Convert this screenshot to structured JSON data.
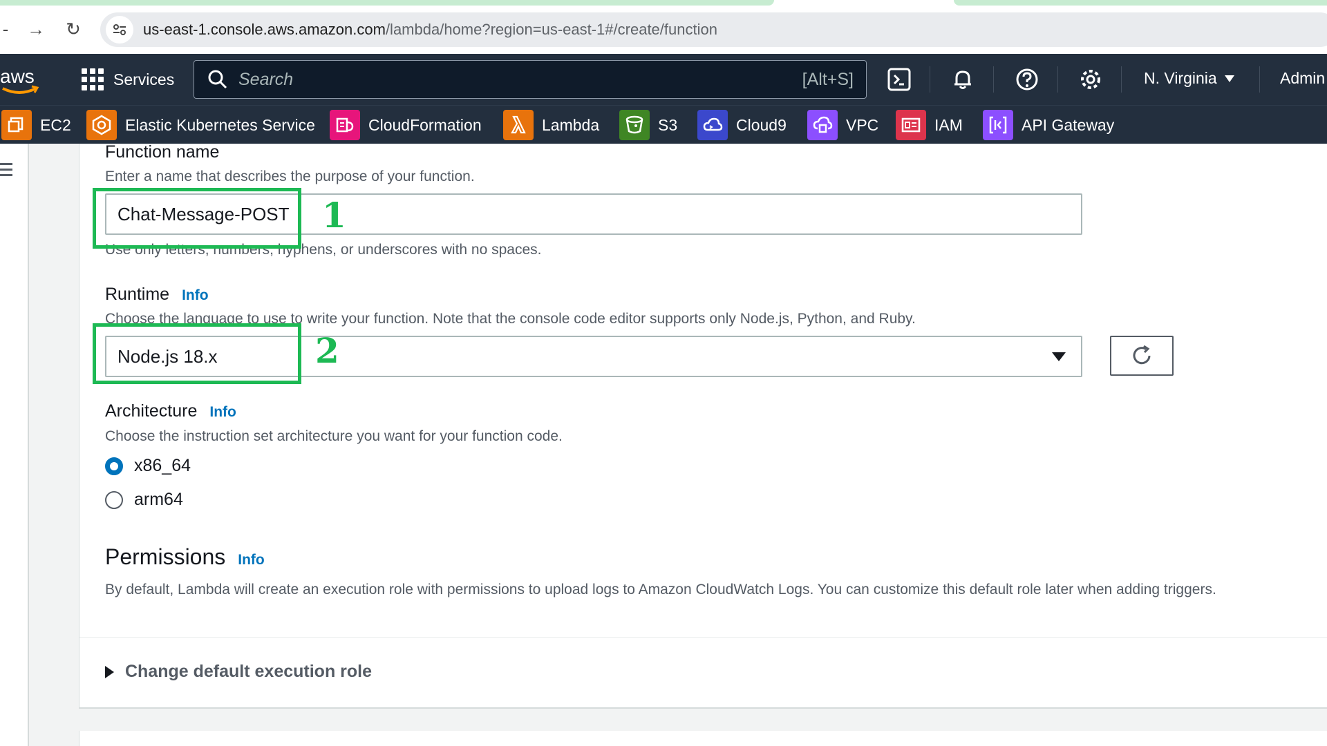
{
  "browser": {
    "back_glyph": "-",
    "forward_glyph": "→",
    "reload_glyph": "↻",
    "url_host": "us-east-1.console.aws.amazon.com",
    "url_path": "/lambda/home?region=us-east-1#/create/function"
  },
  "aws_nav": {
    "logo_text": "aws",
    "services_label": "Services",
    "search_placeholder": "Search",
    "search_shortcut": "[Alt+S]",
    "region_label": "N. Virginia",
    "account_label": "Admin"
  },
  "favorites": [
    {
      "label": "EC2",
      "color": "#e8730c",
      "icon": "ec2-icon"
    },
    {
      "label": "Elastic Kubernetes Service",
      "color": "#e8730c",
      "icon": "eks-icon"
    },
    {
      "label": "CloudFormation",
      "color": "#e7157b",
      "icon": "cloudformation-icon"
    },
    {
      "label": "Lambda",
      "color": "#e8730c",
      "icon": "lambda-icon"
    },
    {
      "label": "S3",
      "color": "#3f8624",
      "icon": "s3-icon"
    },
    {
      "label": "Cloud9",
      "color": "#3b48cc",
      "icon": "cloud9-icon"
    },
    {
      "label": "VPC",
      "color": "#8c4fff",
      "icon": "vpc-icon"
    },
    {
      "label": "IAM",
      "color": "#dd344c",
      "icon": "iam-icon"
    },
    {
      "label": "API Gateway",
      "color": "#8c4fff",
      "icon": "api-gateway-icon"
    }
  ],
  "form": {
    "function_name": {
      "label": "Function name",
      "description": "Enter a name that describes the purpose of your function.",
      "value": "Chat-Message-POST",
      "constraint": "Use only letters, numbers, hyphens, or underscores with no spaces."
    },
    "runtime": {
      "label": "Runtime",
      "info": "Info",
      "description": "Choose the language to use to write your function. Note that the console code editor supports only Node.js, Python, and Ruby.",
      "selected": "Node.js 18.x"
    },
    "architecture": {
      "label": "Architecture",
      "info": "Info",
      "description": "Choose the instruction set architecture you want for your function code.",
      "options": [
        {
          "label": "x86_64",
          "checked": true
        },
        {
          "label": "arm64",
          "checked": false
        }
      ]
    },
    "permissions": {
      "title": "Permissions",
      "info": "Info",
      "description": "By default, Lambda will create an execution role with permissions to upload logs to Amazon CloudWatch Logs. You can customize this default role later when adding triggers.",
      "expander_label": "Change default execution role"
    }
  },
  "annotations": {
    "step1": "1",
    "step2": "2",
    "color": "#1db954"
  }
}
